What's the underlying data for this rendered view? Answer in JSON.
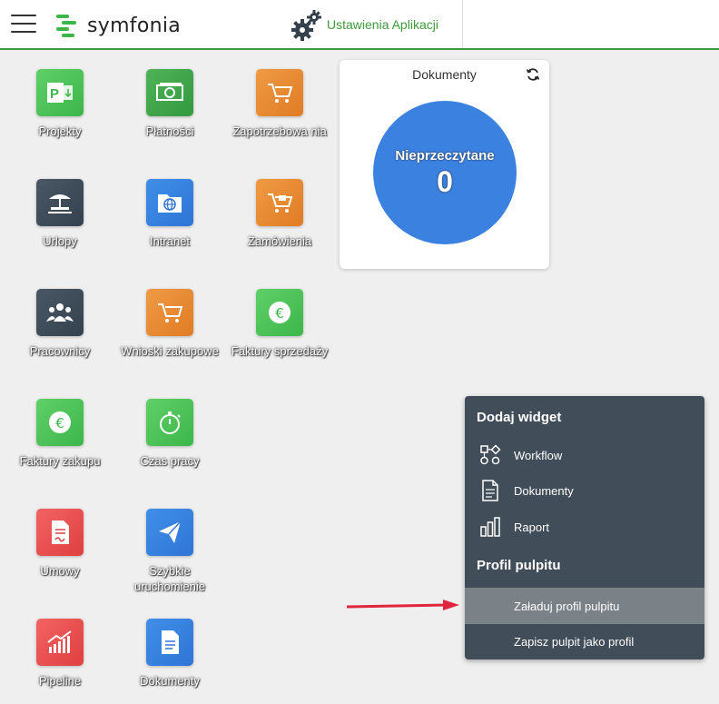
{
  "header": {
    "logo_text": "symfonia",
    "settings_label": "Ustawienia Aplikacji"
  },
  "tiles": [
    {
      "label": "Projekty",
      "icon": "project-icon"
    },
    {
      "label": "Płatności",
      "icon": "money-icon"
    },
    {
      "label": "Zapotrzebowa nia",
      "icon": "cart-icon"
    },
    {
      "label": "Urlopy",
      "icon": "beach-icon"
    },
    {
      "label": "Intranet",
      "icon": "globe-folder-icon"
    },
    {
      "label": "Zamówienia",
      "icon": "cart-icon"
    },
    {
      "label": "Pracownicy",
      "icon": "people-icon"
    },
    {
      "label": "Wnioski zakupowe",
      "icon": "cart-icon"
    },
    {
      "label": "Faktury sprzedaży",
      "icon": "euro-icon"
    },
    {
      "label": "Faktury zakupu",
      "icon": "euro-icon"
    },
    {
      "label": "Czas pracy",
      "icon": "stopwatch-icon"
    },
    {
      "label": "Umowy",
      "icon": "contract-icon"
    },
    {
      "label": "Szybkie uruchomienie",
      "icon": "paper-plane-icon"
    },
    {
      "label": "Pipeline",
      "icon": "chart-icon"
    },
    {
      "label": "Dokumenty",
      "icon": "document-icon"
    }
  ],
  "widget": {
    "title": "Dokumenty",
    "circle_label": "Nieprzeczytane",
    "count": "0"
  },
  "menu": {
    "section1": "Dodaj widget",
    "workflow": "Workflow",
    "dokumenty": "Dokumenty",
    "raport": "Raport",
    "section2": "Profil pulpitu",
    "load_profile": "Załaduj profil pulpitu",
    "save_profile": "Zapisz pulpit jako profil"
  },
  "colors": {
    "brand_green": "#3f9a3a",
    "menu_bg": "#414d59",
    "menu_active": "#7a8288",
    "widget_circle": "#3b82e0",
    "arrow": "#e0263f"
  }
}
